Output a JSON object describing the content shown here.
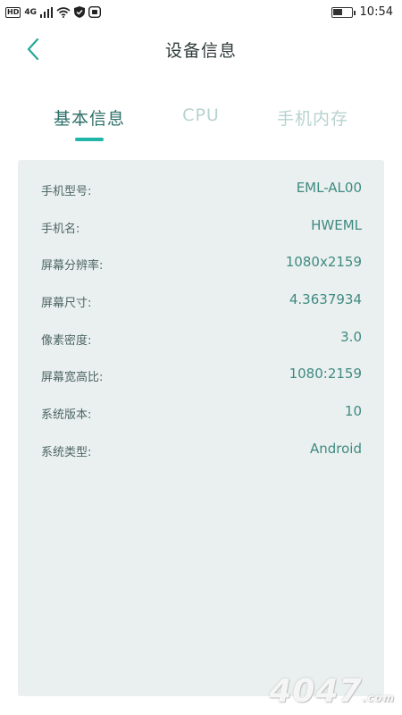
{
  "status_bar": {
    "hd": "HD",
    "signal": "4G",
    "time": "10:54",
    "battery_level": 0.55,
    "icons": [
      "hd-icon",
      "signal-icon",
      "wifi-icon",
      "vpn-shield-icon",
      "app-icon",
      "battery-icon"
    ]
  },
  "header": {
    "title": "设备信息",
    "back_icon": "chevron-left-icon"
  },
  "tabs": [
    {
      "label": "基本信息",
      "active": true
    },
    {
      "label": "CPU",
      "active": false
    },
    {
      "label": "手机内存",
      "active": false
    }
  ],
  "rows": [
    {
      "label": "手机型号:",
      "value": "EML-AL00"
    },
    {
      "label": "手机名:",
      "value": "HWEML"
    },
    {
      "label": "屏幕分辨率:",
      "value": "1080x2159"
    },
    {
      "label": "屏幕尺寸:",
      "value": "4.3637934"
    },
    {
      "label": "像素密度:",
      "value": "3.0"
    },
    {
      "label": "屏幕宽高比:",
      "value": "1080:2159"
    },
    {
      "label": "系统版本:",
      "value": "10"
    },
    {
      "label": "系统类型:",
      "value": "Android"
    }
  ],
  "colors": {
    "accent": "#20b5a6",
    "tab_active": "#2c6f68",
    "tab_inactive": "#b7d3cf",
    "card_bg": "#eaf0ef",
    "value_text": "#3f8a82"
  },
  "watermark": "4047",
  "watermark_suffix": ".com"
}
